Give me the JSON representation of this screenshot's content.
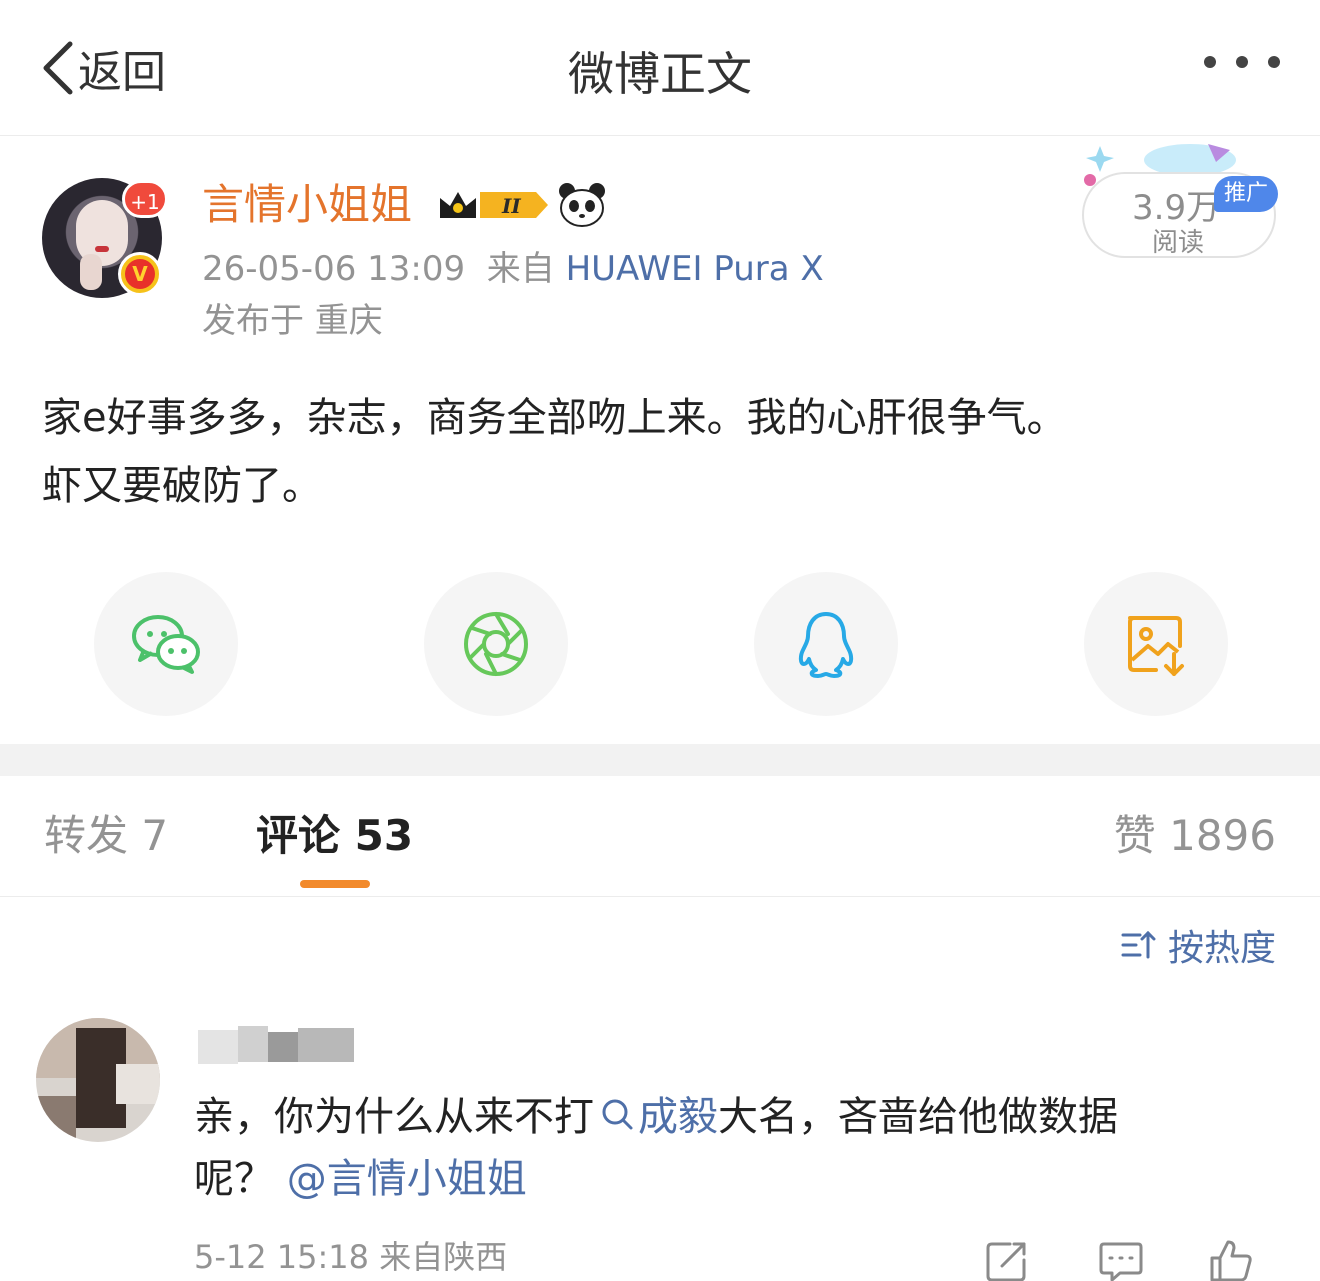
{
  "header": {
    "back_label": "返回",
    "title": "微博正文",
    "more_icon": "ellipsis-icon"
  },
  "post": {
    "user": {
      "name": "言情小姐姐",
      "plus_badge": "+1",
      "verified_badge": "V",
      "crown_badge": "II"
    },
    "time": "26-05-06 13:09",
    "source_prefix": "来自",
    "device": "HUAWEI Pura X",
    "location": "发布于 重庆",
    "reads": "3.9万",
    "reads_label": "阅读",
    "ad_tag": "推广",
    "text_line1": "家e好事多多，杂志，商务全部吻上来。我的心肝很争气。",
    "text_line2": "虾又要破防了。"
  },
  "share": [
    {
      "name": "wechat-icon",
      "color": "#4cc16a"
    },
    {
      "name": "moments-icon",
      "color": "#66c85a"
    },
    {
      "name": "qq-icon",
      "color": "#27a9e6"
    },
    {
      "name": "save-image-icon",
      "color": "#f0a21c"
    }
  ],
  "tabs": {
    "repost": "转发 7",
    "comment": "评论 53",
    "like": "赞 1896",
    "accent": "#f28a2c"
  },
  "sort_label": "按热度",
  "comment": {
    "text_before": "亲，你为什么从来不打",
    "topic": "成毅",
    "text_after": "大名，吝啬给他做数据",
    "text_line2_prefix": "呢？",
    "mention": "@言情小姐姐",
    "meta": "5-12 15:18 来自陕西"
  }
}
